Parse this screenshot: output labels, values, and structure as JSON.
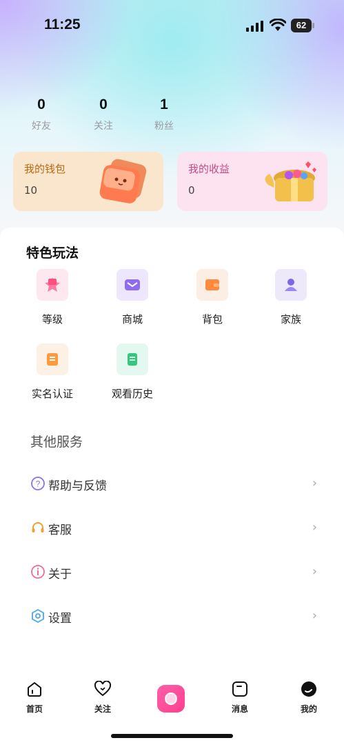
{
  "status_bar": {
    "time": "11:25",
    "battery": "62"
  },
  "stats": [
    {
      "value": "0",
      "label": "好友"
    },
    {
      "value": "0",
      "label": "关注"
    },
    {
      "value": "1",
      "label": "粉丝"
    }
  ],
  "wallet": {
    "title": "我的钱包",
    "value": "10"
  },
  "income": {
    "title": "我的收益",
    "value": "0"
  },
  "features": {
    "title": "特色玩法",
    "items": [
      {
        "label": "等级",
        "icon": "level-icon"
      },
      {
        "label": "商城",
        "icon": "mall-icon"
      },
      {
        "label": "背包",
        "icon": "backpack-icon"
      },
      {
        "label": "家族",
        "icon": "family-icon"
      },
      {
        "label": "实名认证",
        "icon": "real-name-icon"
      },
      {
        "label": "观看历史",
        "icon": "history-icon"
      }
    ]
  },
  "services": {
    "title": "其他服务",
    "items": [
      {
        "label": "帮助与反馈",
        "icon": "help-icon"
      },
      {
        "label": "客服",
        "icon": "headset-icon"
      },
      {
        "label": "关于",
        "icon": "info-icon"
      },
      {
        "label": "设置",
        "icon": "settings-icon"
      }
    ]
  },
  "tabbar": [
    {
      "label": "首页",
      "icon": "home-icon"
    },
    {
      "label": "关注",
      "icon": "heart-icon"
    },
    {
      "label": "",
      "icon": "camera-icon"
    },
    {
      "label": "消息",
      "icon": "message-icon"
    },
    {
      "label": "我的",
      "icon": "profile-icon"
    }
  ],
  "colors": {
    "accent": "#ff4f9a",
    "wallet_bg": "#f9e6cd",
    "income_bg": "#fde3f0"
  }
}
